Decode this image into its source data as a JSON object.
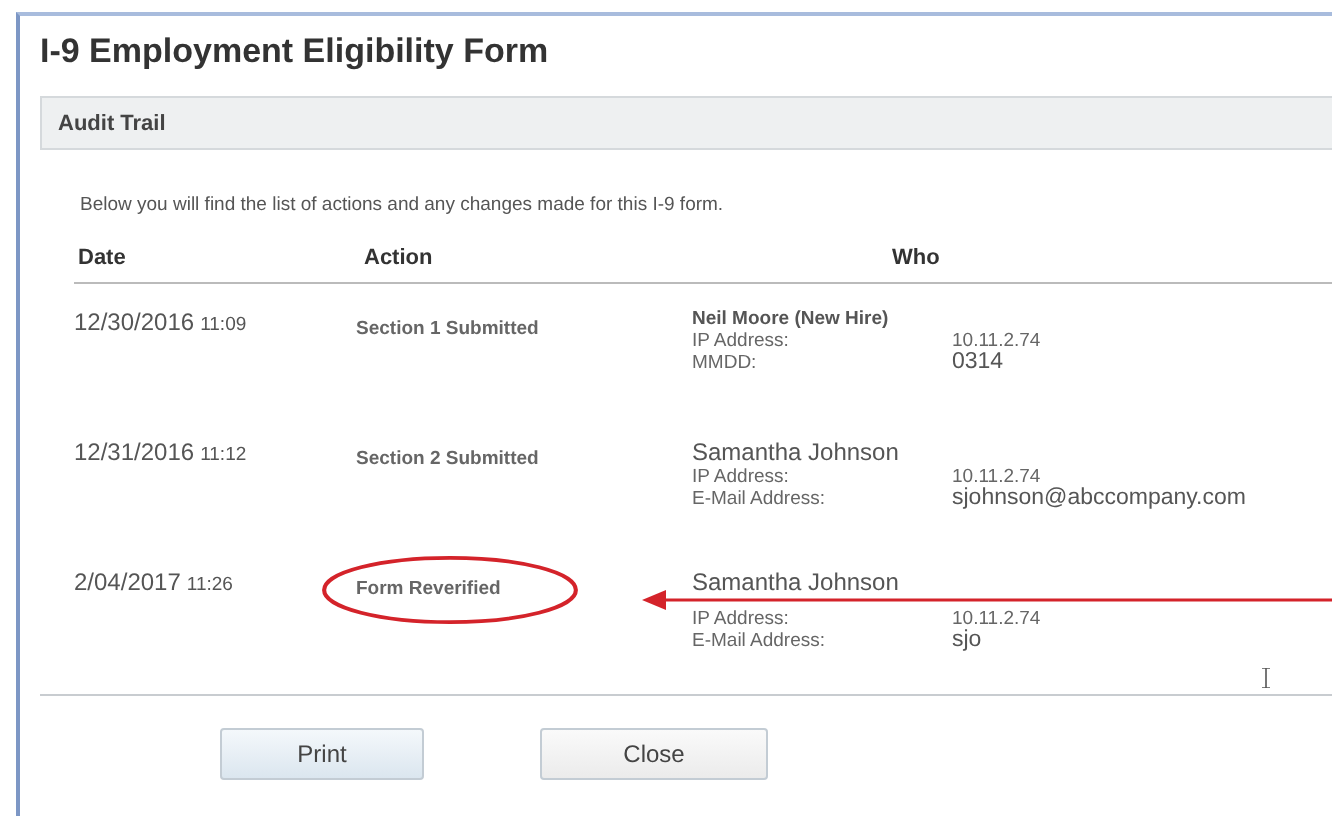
{
  "window": {
    "title": "I-9 Employment Eligibility Form"
  },
  "section": {
    "title": "Audit Trail"
  },
  "intro": "Below you will find the list of actions and any changes made for this I-9 form.",
  "table": {
    "columns": [
      "Date",
      "Action",
      "Who"
    ],
    "rows": [
      {
        "date": "12/30/2016",
        "time": "11:09",
        "action": "Section 1 Submitted",
        "name": "Neil Moore (New Hire)",
        "name_bold": true,
        "highlighted": false,
        "details": [
          {
            "label": "IP Address:",
            "value": "10.11.2.74"
          },
          {
            "label": "MMDD:",
            "value": "0314"
          }
        ]
      },
      {
        "date": "12/31/2016",
        "time": "11:12",
        "action": "Section 2 Submitted",
        "name": "Samantha Johnson",
        "name_bold": false,
        "highlighted": false,
        "details": [
          {
            "label": "IP Address:",
            "value": "10.11.2.74"
          },
          {
            "label": "E-Mail Address:",
            "value": "sjohnson@abccompany.com"
          }
        ]
      },
      {
        "date": "2/04/2017",
        "time": "11:26",
        "action": "Form Reverified",
        "name": "Samantha Johnson",
        "name_bold": false,
        "highlighted": true,
        "details": [
          {
            "label": "IP Address:",
            "value": "10.11.2.74"
          },
          {
            "label": "E-Mail Address:",
            "value": "sjo"
          }
        ]
      }
    ]
  },
  "buttons": [
    "Print",
    "Close"
  ]
}
